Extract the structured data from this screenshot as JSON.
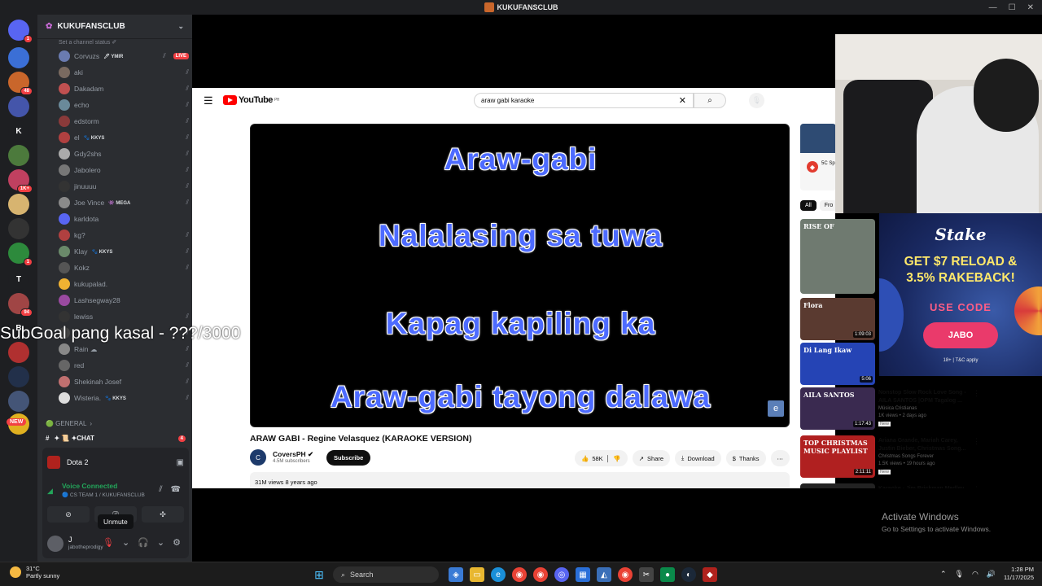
{
  "window": {
    "title": "KUKUFANSCLUB",
    "controls": [
      "—",
      "☐",
      "✕"
    ]
  },
  "server": {
    "name": "KUKUFANSCLUB",
    "status_placeholder": "Set a channel status ✐"
  },
  "server_list": [
    {
      "label": "",
      "badge": "1",
      "color": "#5865f2"
    },
    {
      "label": "",
      "badge": "",
      "color": "#3b6fd6"
    },
    {
      "label": "",
      "badge": "48",
      "color": "#c9662b"
    },
    {
      "label": "",
      "badge": "",
      "color": "#4455aa"
    },
    {
      "label": "K",
      "badge": "",
      "color": "#1e1f22"
    },
    {
      "label": "",
      "badge": "",
      "color": "#4c7a3c"
    },
    {
      "label": "",
      "badge": "1K+",
      "color": "#c04060"
    },
    {
      "label": "",
      "badge": "",
      "color": "#d7b470"
    },
    {
      "label": "",
      "badge": "",
      "color": "#333"
    },
    {
      "label": "",
      "badge": "1",
      "color": "#2d8a3c"
    },
    {
      "label": "T",
      "badge": "",
      "color": "#1e1f22"
    },
    {
      "label": "",
      "badge": "94",
      "color": "#a04545"
    },
    {
      "label": "B",
      "badge": "",
      "color": "#1e1f22"
    },
    {
      "label": "",
      "badge": "",
      "color": "#b03030"
    },
    {
      "label": "",
      "badge": "",
      "color": "#22304a"
    },
    {
      "label": "",
      "badge": "",
      "color": "#445577"
    },
    {
      "label": "",
      "badge": "",
      "color": "#e0b020"
    }
  ],
  "new_badge": "NEW",
  "members": [
    {
      "name": "Corvuzs",
      "tag": "🖊 YMIR",
      "muted": true,
      "live": "LIVE",
      "color": "#6a7bb0"
    },
    {
      "name": "aki",
      "tag": "",
      "muted": true,
      "live": "",
      "color": "#7a6a60"
    },
    {
      "name": "Dakadam",
      "tag": "",
      "muted": true,
      "live": "",
      "color": "#c05050"
    },
    {
      "name": "echo",
      "tag": "",
      "muted": true,
      "live": "",
      "color": "#6a8a9a"
    },
    {
      "name": "edstorm",
      "tag": "",
      "muted": true,
      "live": "",
      "color": "#8a3a3a"
    },
    {
      "name": "el",
      "tag": "🐾 KKYS",
      "muted": true,
      "live": "",
      "color": "#b04040"
    },
    {
      "name": "Gdy2shs",
      "tag": "",
      "muted": true,
      "live": "",
      "color": "#aaa"
    },
    {
      "name": "Jabolero",
      "tag": "",
      "muted": true,
      "live": "",
      "color": "#777"
    },
    {
      "name": "jinuuuu",
      "tag": "",
      "muted": true,
      "live": "",
      "color": "#333"
    },
    {
      "name": "Joe Vince",
      "tag": "👾 MEGA",
      "muted": true,
      "live": "",
      "color": "#8a8a8a"
    },
    {
      "name": "karldota",
      "tag": "",
      "muted": false,
      "live": "",
      "color": "#5865f2"
    },
    {
      "name": "kg?",
      "tag": "",
      "muted": true,
      "live": "",
      "color": "#b04040"
    },
    {
      "name": "Klay",
      "tag": "🐾 KKYS",
      "muted": true,
      "live": "",
      "color": "#6a8a6a"
    },
    {
      "name": "Kokz",
      "tag": "",
      "muted": true,
      "live": "",
      "color": "#555"
    },
    {
      "name": "kukupalad.",
      "tag": "",
      "muted": false,
      "live": "",
      "color": "#f0b232"
    },
    {
      "name": "Lashsegway28",
      "tag": "",
      "muted": false,
      "live": "",
      "color": "#9a4aa0"
    },
    {
      "name": "lewiss",
      "tag": "",
      "muted": true,
      "live": "",
      "color": "#333"
    },
    {
      "name": "",
      "tag": "",
      "muted": true,
      "live": "",
      "color": "#444"
    },
    {
      "name": "Rain ☁",
      "tag": "",
      "muted": true,
      "live": "",
      "color": "#888"
    },
    {
      "name": "red",
      "tag": "",
      "muted": true,
      "live": "",
      "color": "#666"
    },
    {
      "name": "Shekinah Josef",
      "tag": "",
      "muted": true,
      "live": "",
      "color": "#c07070"
    },
    {
      "name": "Wisteria.",
      "tag": "🐾 KKYS",
      "muted": true,
      "live": "",
      "color": "#ddd"
    }
  ],
  "category": {
    "label": "🟢 GENERAL",
    "chevron": "›"
  },
  "channel": {
    "label": "✦ 📜 ✦CHAT",
    "count": "4"
  },
  "activity": {
    "game": "Dota 2"
  },
  "voice": {
    "status": "Voice Connected",
    "location": "🔵 CS TEAM 1 / KUKUFANSCLUB"
  },
  "user": {
    "name": "J",
    "handle": "jabotheprodigy"
  },
  "tooltip": "Unmute",
  "subgoal": "SubGoal pang kasal - ???/3000",
  "youtube": {
    "logo": "YouTube",
    "region": "PH",
    "search_value": "araw gabi karaoke",
    "lyrics": [
      "Araw-gabi",
      "Nalalasing sa tuwa",
      "Kapag kapiling ka",
      "Araw-gabi tayong dalawa"
    ],
    "video_title": "ARAW GABI - Regine Velasquez (KARAOKE VERSION)",
    "channel_name": "CoversPH",
    "subscribers": "4.5M subscribers",
    "subscribe": "Subscribe",
    "likes": "58K",
    "share": "Share",
    "download": "Download",
    "thanks": "Thanks",
    "views": "31M views",
    "age": "8 years ago",
    "chips": [
      "All",
      "Fro"
    ],
    "ad_text": "5C Sp",
    "recommendations": [
      {
        "title": "",
        "channel": "",
        "views": "",
        "duration": "",
        "thumb_text": "RISE OF",
        "thumb_color": "#6f7a70",
        "new": ""
      },
      {
        "title": "",
        "channel": "",
        "views": "",
        "duration": "1:09:03",
        "thumb_text": "Flora",
        "thumb_color": "#5a3a30",
        "new": ""
      },
      {
        "title": "",
        "channel": "",
        "views": "",
        "duration": "5:06",
        "thumb_text": "Di Lang Ikaw",
        "thumb_color": "#2544b5",
        "new": ""
      },
      {
        "title": "Nonstop Slow Rock Love Song - AILA SANTOS |OPM Tagalog ...",
        "channel": "Música Cristianas",
        "views": "1K views • 2 days ago",
        "duration": "1:17:43",
        "thumb_text": "AILA SANTOS",
        "thumb_color": "#3a2a50",
        "new": "New"
      },
      {
        "title": "Ariana Grande, Mariah Carey, Justin Bieber, Christmas Song...",
        "channel": "Christmas Songs Forever",
        "views": "1.5K views • 19 hours ago",
        "duration": "2:11:11",
        "thumb_text": "TOP CHRISTMAS MUSIC PLAYLIST",
        "thumb_color": "#b02020",
        "new": "New"
      },
      {
        "title": "Karaoke - Jim Brickman Medley",
        "channel": "",
        "views": "",
        "duration": "",
        "thumb_text": "",
        "thumb_color": "#222",
        "new": ""
      }
    ]
  },
  "stake": {
    "logo": "Stake",
    "offer_line1": "GET $7 RELOAD &",
    "offer_line2": "3.5% RAKEBACK!",
    "use_code": "USE CODE",
    "code": "JABO",
    "terms": "18+ | T&C apply"
  },
  "activate": {
    "title": "Activate Windows",
    "subtitle": "Go to Settings to activate Windows."
  },
  "taskbar": {
    "weather_temp": "31°C",
    "weather_desc": "Partly sunny",
    "search": "Search",
    "time": "1:28 PM",
    "date": "11/17/2025"
  }
}
